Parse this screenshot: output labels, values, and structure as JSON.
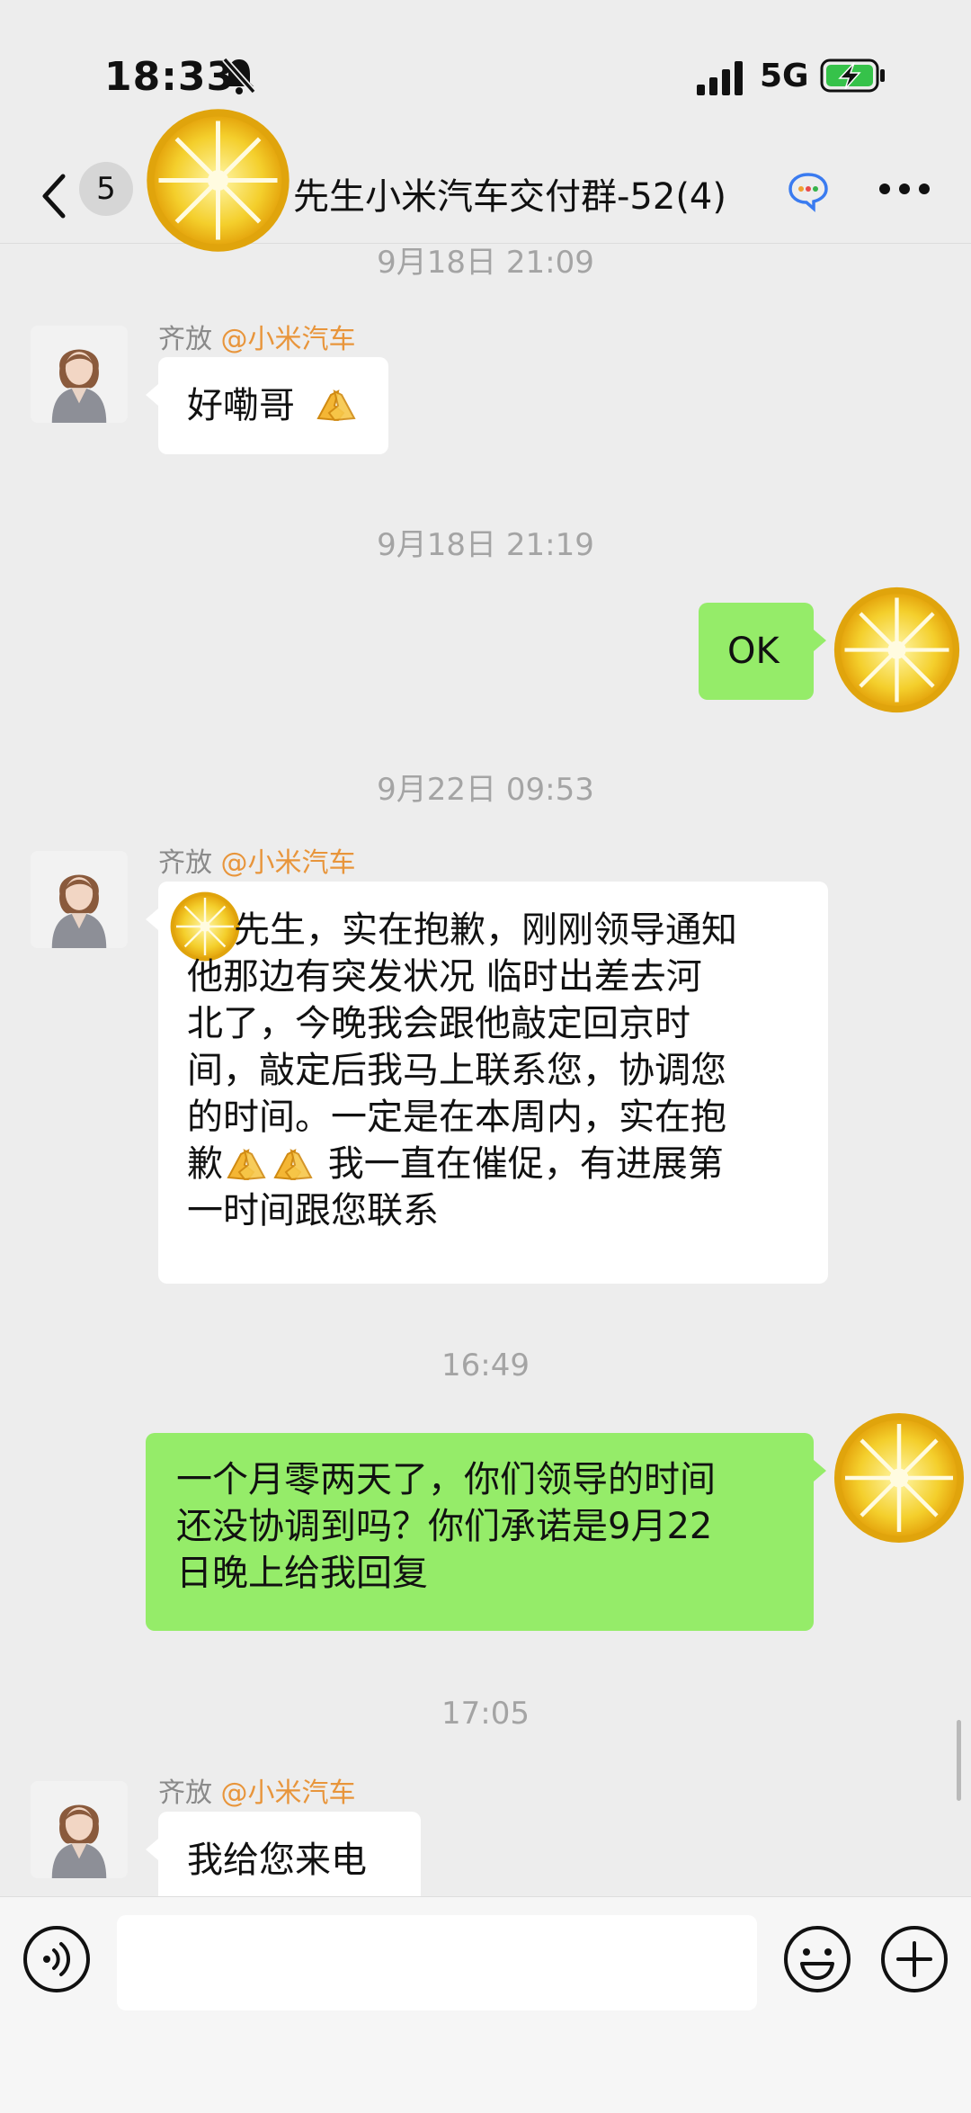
{
  "status_bar": {
    "time": "18:33",
    "network": "5G"
  },
  "nav": {
    "unread_count": "5",
    "title": "先生小米汽车交付群-52(4)"
  },
  "messages": [
    {
      "timestamp": "9月18日 21:09"
    },
    {
      "sender_name": "齐放",
      "sender_org": "@小米汽车",
      "text": "好嘞哥"
    },
    {
      "timestamp": "9月18日 21:19"
    },
    {
      "text": "OK"
    },
    {
      "timestamp": "9月22日 09:53"
    },
    {
      "sender_name": "齐放",
      "sender_org": "@小米汽车",
      "lines": [
        "先生，实在抱歉，刚刚领导通知",
        "他那边有突发状况 临时出差去河",
        "北了，今晚我会跟他敲定回京时",
        "间，敲定后我马上联系您，协调您",
        "的时间。一定是在本周内，实在抱",
        "歉",
        " 我一直在催促，有进展第",
        "一时间跟您联系"
      ]
    },
    {
      "timestamp": "16:49"
    },
    {
      "lines": [
        "一个月零两天了，你们领导的时间",
        "还没协调到吗？你们承诺是9月22",
        "日晚上给我回复"
      ]
    },
    {
      "timestamp": "17:05"
    },
    {
      "sender_name": "齐放",
      "sender_org": "@小米汽车",
      "text": "我给您来电"
    }
  ],
  "input": {
    "value": ""
  },
  "icons": {
    "back": "chevron-left-icon",
    "mute": "bell-slash-icon",
    "group": "group-chat-icon",
    "more": "more-dots-icon",
    "voice": "voice-icon",
    "emoji": "emoji-icon",
    "plus": "plus-icon",
    "praying": "praying-hands-emoji"
  },
  "colors": {
    "outgoing_bubble": "#95ec69",
    "incoming_bubble": "#ffffff",
    "background": "#ededed",
    "org_tag": "#e8953b"
  }
}
